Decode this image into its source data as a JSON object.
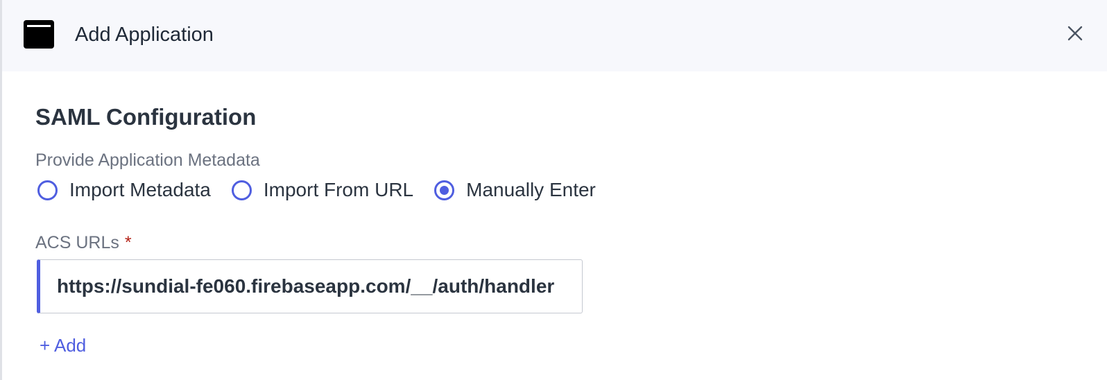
{
  "header": {
    "title": "Add Application",
    "icon": "application-window-icon",
    "close_icon": "close-icon"
  },
  "saml": {
    "section_title": "SAML Configuration",
    "metadata_label": "Provide Application Metadata",
    "options": [
      {
        "label": "Import Metadata",
        "selected": false
      },
      {
        "label": "Import From URL",
        "selected": false
      },
      {
        "label": "Manually Enter",
        "selected": true
      }
    ],
    "acs_label": "ACS URLs",
    "required_marker": "*",
    "acs_value": "https://sundial-fe060.firebaseapp.com/__/auth/handler",
    "add_label": "+ Add"
  },
  "colors": {
    "accent": "#4f5ee0",
    "required": "#b42318",
    "header_bg": "#f7f8fc"
  }
}
